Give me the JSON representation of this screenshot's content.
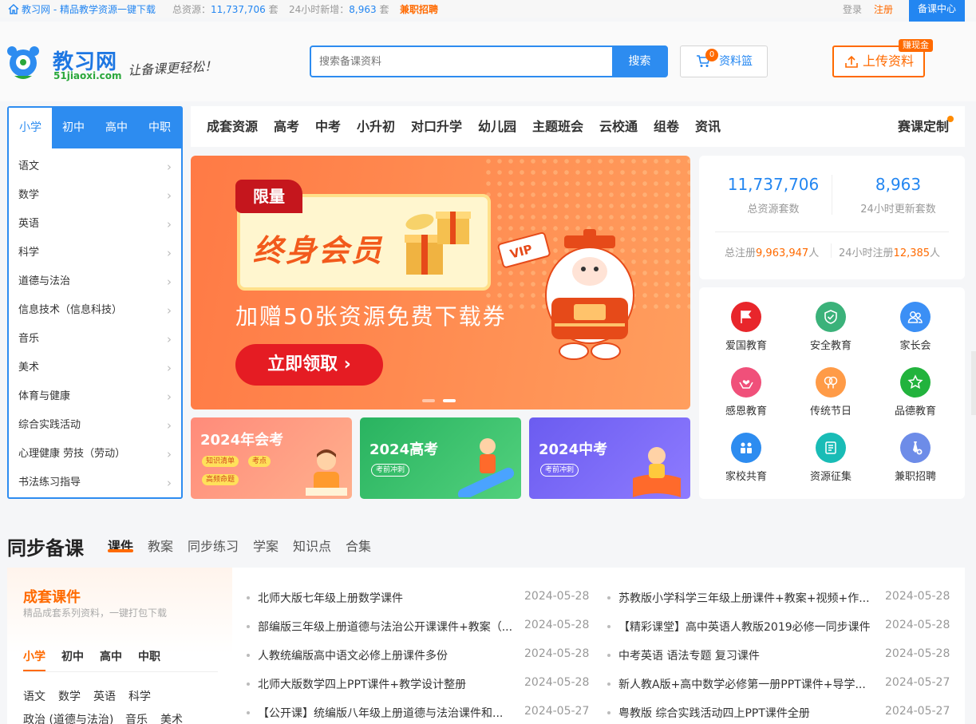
{
  "topbar": {
    "site_link": "教习网 - 精品教学资源一键下载",
    "total_label": "总资源：",
    "total_value": "11,737,706",
    "total_unit": "套",
    "new_label": "24小时新增：",
    "new_value": "8,963",
    "new_unit": "套",
    "recruit": "兼职招聘",
    "login": "登录",
    "register": "注册",
    "prep_center": "备课中心"
  },
  "header": {
    "logo_cn": "教习网",
    "logo_en": "51jiaoxi.com",
    "slogan": "让备课更轻松！",
    "search_placeholder": "搜索备课资料",
    "search_button": "搜索",
    "basket_label": "资料篮",
    "basket_count": "0",
    "upload_label": "上传资料",
    "earn_badge": "赚现金"
  },
  "category": {
    "tabs": [
      "小学",
      "初中",
      "高中",
      "中职"
    ],
    "active_tab": "小学",
    "items": [
      "语文",
      "数学",
      "英语",
      "科学",
      "道德与法治",
      "信息技术（信息科技）",
      "音乐",
      "美术",
      "体育与健康",
      "综合实践活动",
      "心理健康  劳技（劳动）",
      "书法练习指导"
    ]
  },
  "nav": {
    "items": [
      "成套资源",
      "高考",
      "中考",
      "小升初",
      "对口升学",
      "幼儿园",
      "主题班会",
      "云校通",
      "组卷",
      "资讯"
    ],
    "right": "赛课定制"
  },
  "banner": {
    "tag": "限量",
    "title": "终身会员",
    "subtitle": "加赠50张资源免费下载券",
    "cta": "立即领取 ›",
    "vip": "VIP"
  },
  "small_banners": [
    {
      "title": "2024年会考",
      "pills": [
        "知识清单",
        "考点",
        "高频命题"
      ]
    },
    {
      "title": "2024高考",
      "pills": [
        "考前冲刺"
      ]
    },
    {
      "title": "2024中考",
      "pills": [
        "考前冲刺"
      ]
    }
  ],
  "stats": {
    "total_value": "11,737,706",
    "total_label": "总资源套数",
    "new_value": "8,963",
    "new_label": "24小时更新套数",
    "reg_total_prefix": "总注册",
    "reg_total_value": "9,963,947",
    "reg_total_suffix": "人",
    "reg_new_prefix": "24小时注册",
    "reg_new_value": "12,385",
    "reg_new_suffix": "人"
  },
  "features": [
    {
      "label": "爱国教育",
      "color": "#e8262b",
      "icon": "flag-icon"
    },
    {
      "label": "安全教育",
      "color": "#3bb27a",
      "icon": "shield-icon"
    },
    {
      "label": "家长会",
      "color": "#3b8ff5",
      "icon": "parents-icon"
    },
    {
      "label": "感恩教育",
      "color": "#f0507a",
      "icon": "heart-hands-icon"
    },
    {
      "label": "传统节日",
      "color": "#ff9b47",
      "icon": "lantern-icon"
    },
    {
      "label": "品德教育",
      "color": "#22b33d",
      "icon": "star-badge-icon"
    },
    {
      "label": "家校共育",
      "color": "#2d8cf0",
      "icon": "home-school-icon"
    },
    {
      "label": "资源征集",
      "color": "#19bcb6",
      "icon": "document-icon"
    },
    {
      "label": "兼职招聘",
      "color": "#6d8ce8",
      "icon": "tie-icon"
    }
  ],
  "sync": {
    "title": "同步备课",
    "tabs": [
      "课件",
      "教案",
      "同步练习",
      "学案",
      "知识点",
      "合集"
    ],
    "active_tab": "课件"
  },
  "set_courses": {
    "title": "成套课件",
    "desc": "精品成套系列资料，一键打包下载",
    "levels": [
      "小学",
      "初中",
      "高中",
      "中职"
    ],
    "subjects_row1": [
      "语文",
      "数学",
      "英语",
      "科学"
    ],
    "subjects_row2": [
      "政治 (道德与法治)",
      "音乐",
      "美术"
    ]
  },
  "list": [
    {
      "title": "北师大版七年级上册数学课件",
      "date": "2024-05-28"
    },
    {
      "title": "苏教版小学科学三年级上册课件+教案+视频+作...",
      "date": "2024-05-28"
    },
    {
      "title": "部编版三年级上册道德与法治公开课课件+教案（...",
      "date": "2024-05-28"
    },
    {
      "title": "【精彩课堂】高中英语人教版2019必修一同步课件",
      "date": "2024-05-28"
    },
    {
      "title": "人教统编版高中语文必修上册课件多份",
      "date": "2024-05-28"
    },
    {
      "title": "中考英语 语法专题 复习课件",
      "date": "2024-05-28"
    },
    {
      "title": "北师大版数学四上PPT课件+教学设计整册",
      "date": "2024-05-28"
    },
    {
      "title": "新人教A版+高中数学必修第一册PPT课件+导学...",
      "date": "2024-05-27"
    },
    {
      "title": "【公开课】统编版八年级上册道德与法治课件和...",
      "date": "2024-05-27"
    },
    {
      "title": "粤教版 综合实践活动四上PPT课件全册",
      "date": "2024-05-27"
    }
  ]
}
